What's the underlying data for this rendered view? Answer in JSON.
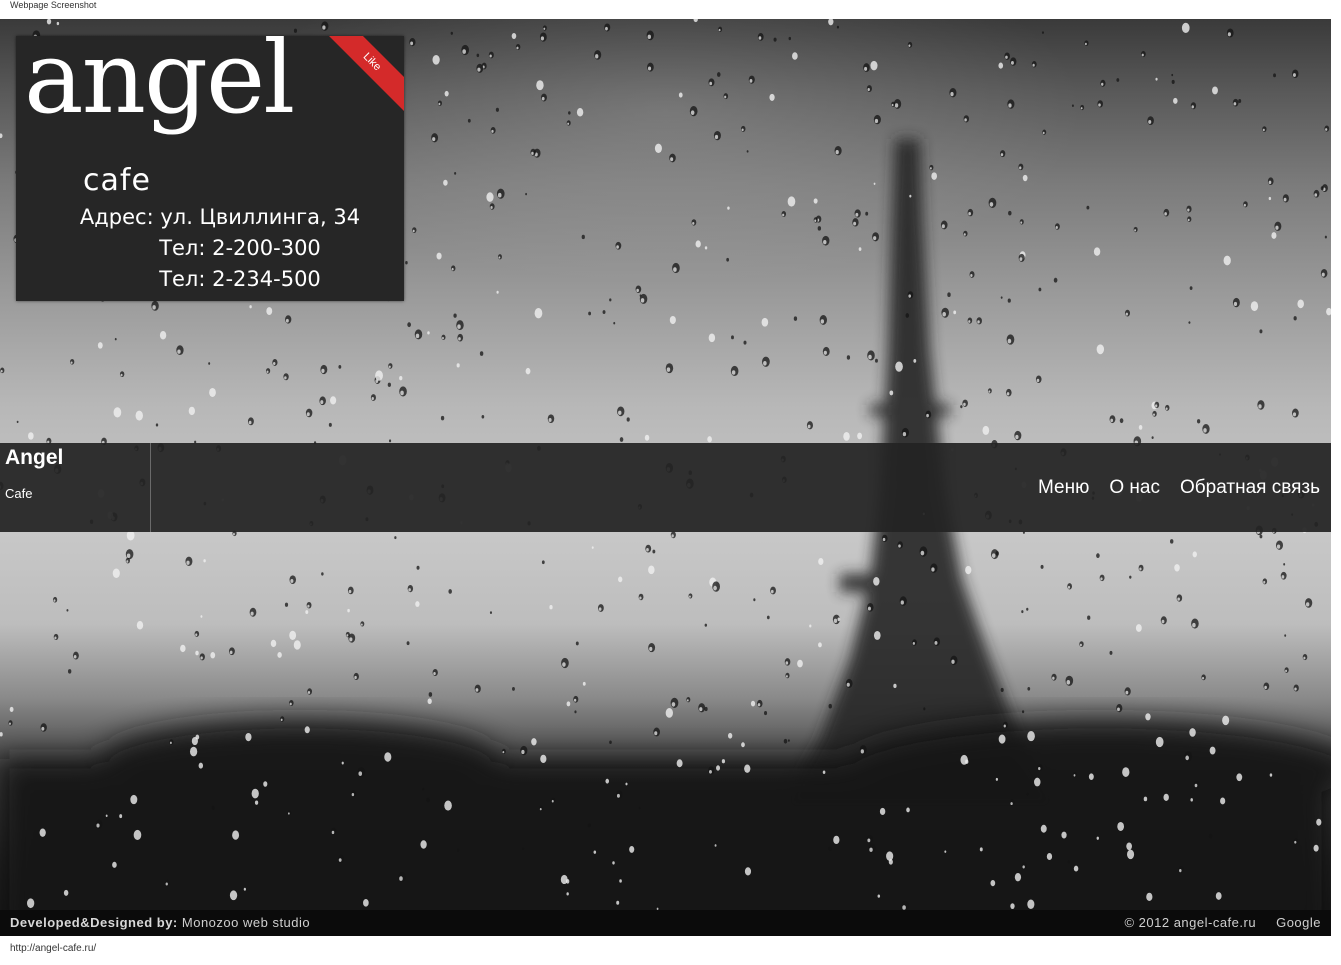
{
  "window": {
    "caption": "Webpage Screenshot",
    "status_url": "http://angel-cafe.ru/"
  },
  "logo": {
    "word": "angel",
    "sub": "cafe",
    "address": "Адрес: ул. Цвиллинга, 34",
    "phone1": "Тел: 2-200-300",
    "phone2": "Тел: 2-234-500",
    "ribbon": "Like"
  },
  "navbar": {
    "brand": "Angel",
    "tagline": "Cafe",
    "items": [
      {
        "label": "Меню"
      },
      {
        "label": "О нас"
      },
      {
        "label": "Обратная связь"
      }
    ]
  },
  "footer": {
    "dev_label": "Developed&Designed by:",
    "dev_name": "Monozoo web studio",
    "copyright": "© 2012 angel-cafe.ru",
    "google": "Google"
  }
}
